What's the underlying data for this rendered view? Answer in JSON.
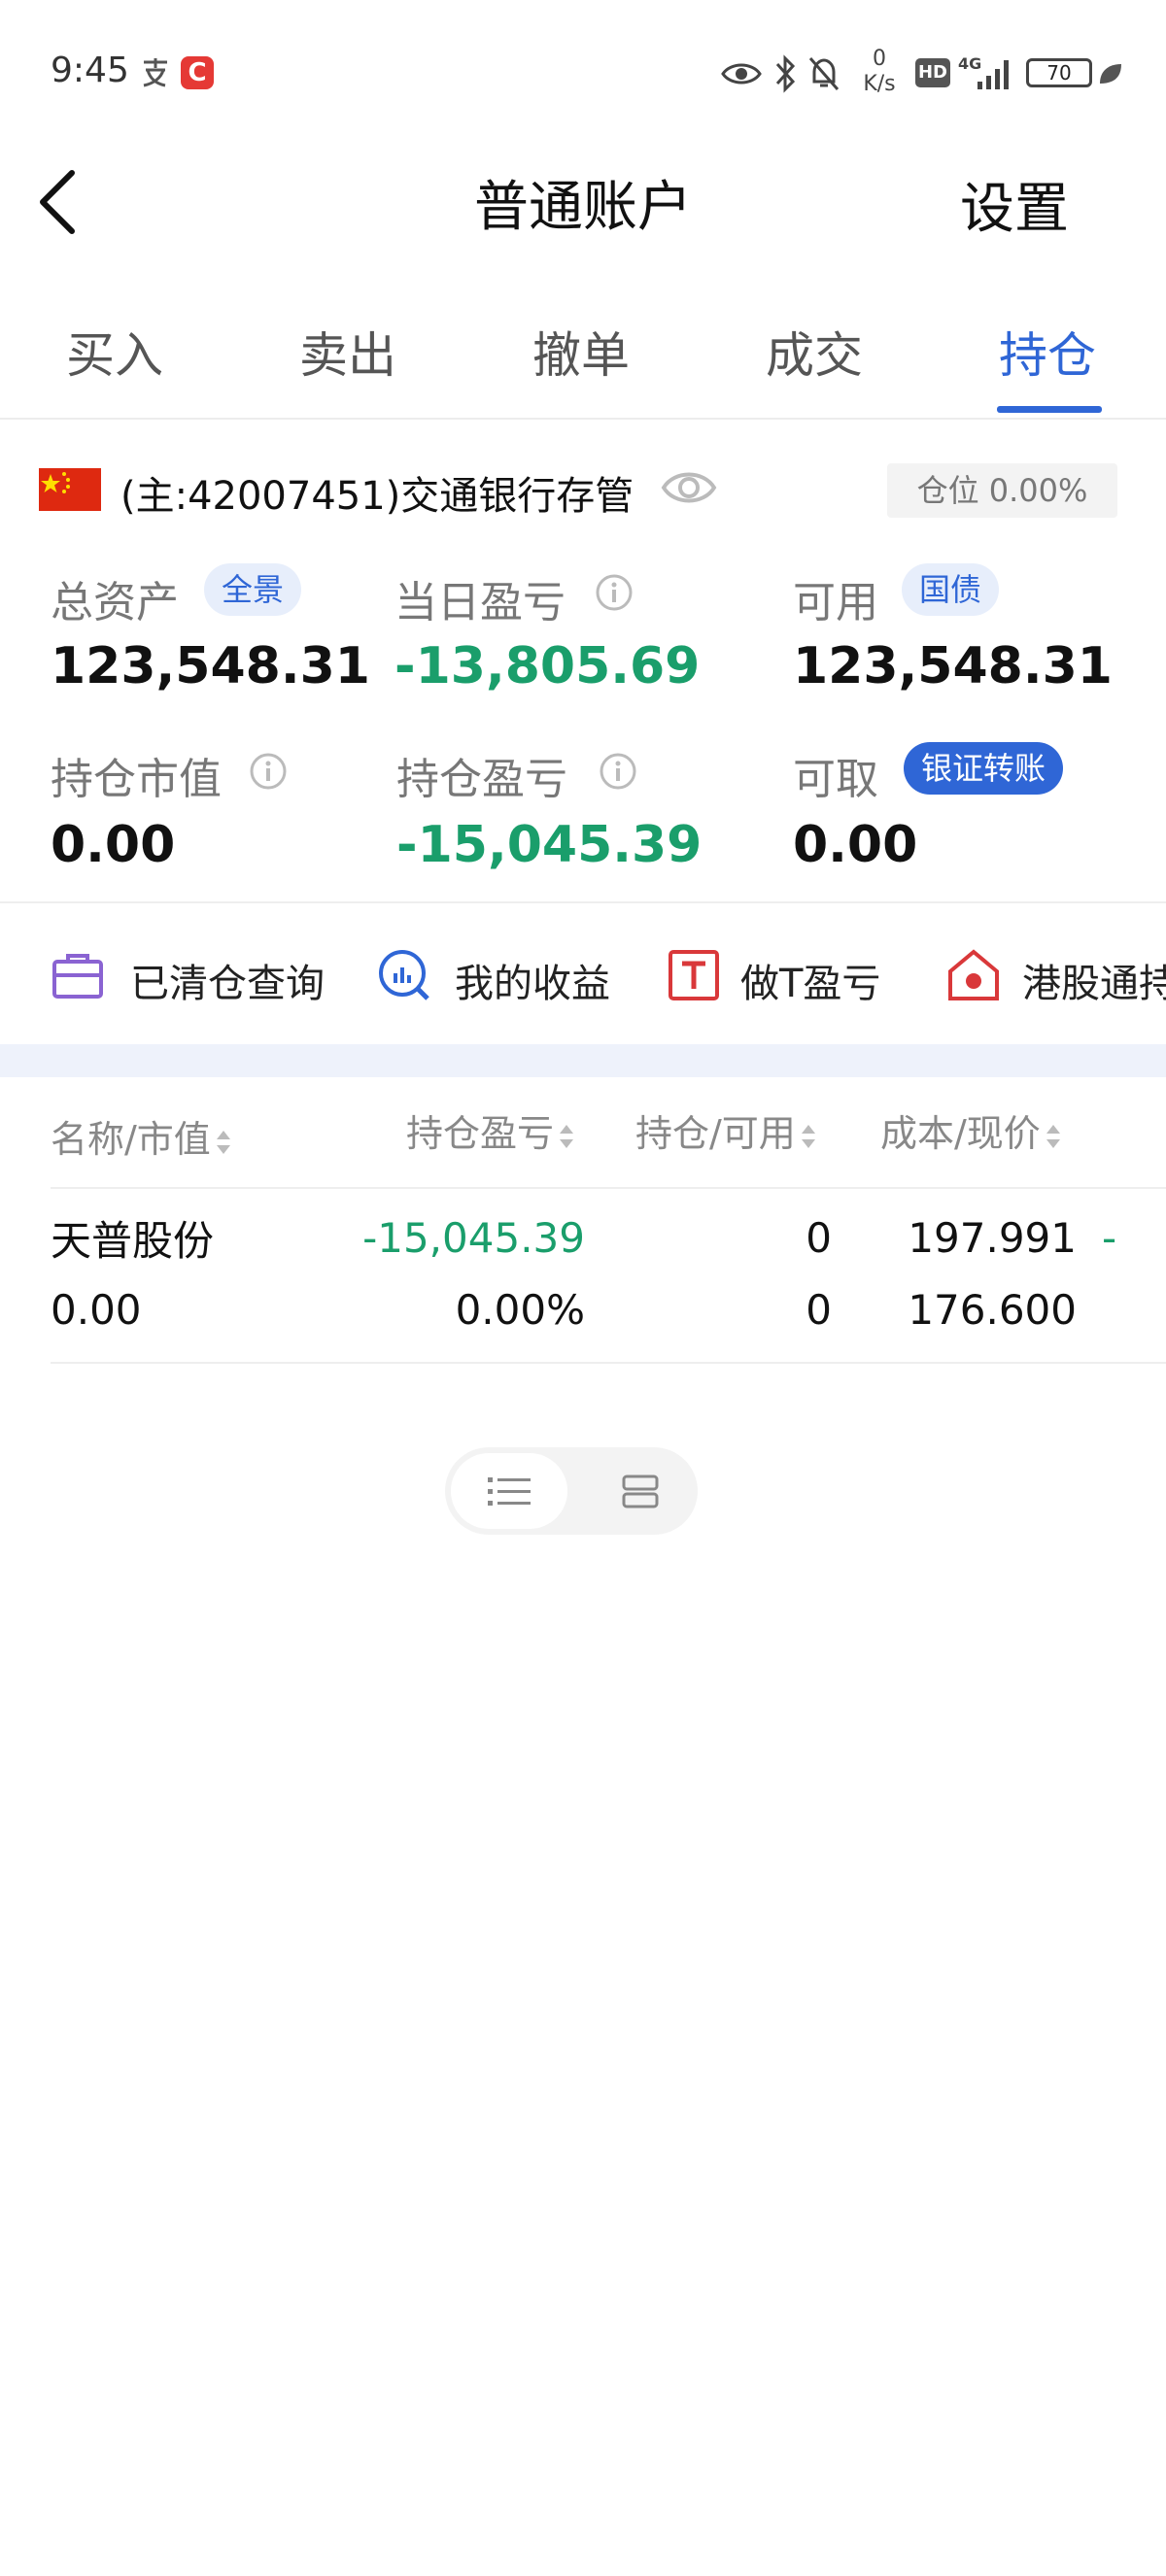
{
  "status_bar": {
    "time": "9:45",
    "speed_value": "0",
    "speed_unit": "K/s",
    "hd": "HD",
    "network": "4G",
    "battery": "70"
  },
  "header": {
    "title": "普通账户",
    "settings_label": "设置"
  },
  "tabs": [
    {
      "label": "买入"
    },
    {
      "label": "卖出"
    },
    {
      "label": "撤单"
    },
    {
      "label": "成交"
    },
    {
      "label": "持仓",
      "active": true
    }
  ],
  "account": {
    "name": "(主:42007451)交通银行存管",
    "position_badge": "仓位 0.00%"
  },
  "stats": {
    "total_assets_label": "总资产",
    "total_assets_chip": "全景",
    "total_assets_value": "123,548.31",
    "daily_pnl_label": "当日盈亏",
    "daily_pnl_value": "-13,805.69",
    "available_label": "可用",
    "available_chip": "国债",
    "available_value": "123,548.31",
    "market_value_label": "持仓市值",
    "market_value_value": "0.00",
    "position_pnl_label": "持仓盈亏",
    "position_pnl_value": "-15,045.39",
    "withdrawable_label": "可取",
    "withdrawable_chip": "银证转账",
    "withdrawable_value": "0.00"
  },
  "quick_actions": [
    {
      "label": "已清仓查询",
      "icon": "briefcase-icon"
    },
    {
      "label": "我的收益",
      "icon": "chart-search-icon"
    },
    {
      "label": "做T盈亏",
      "icon": "t-box-icon"
    },
    {
      "label": "港股通持",
      "icon": "hk-house-icon"
    }
  ],
  "table": {
    "headers": [
      "名称/市值",
      "持仓盈亏",
      "持仓/可用",
      "成本/现价"
    ],
    "rows": [
      {
        "name": "天普股份",
        "market_value": "0.00",
        "pnl": "-15,045.39",
        "pnl_pct": "0.00%",
        "position": "0",
        "available": "0",
        "cost": "197.991",
        "price": "176.600",
        "extra": "-"
      }
    ]
  },
  "colors": {
    "accent": "#2f66d6",
    "loss_green": "#1a9e6b",
    "muted": "#777777"
  }
}
